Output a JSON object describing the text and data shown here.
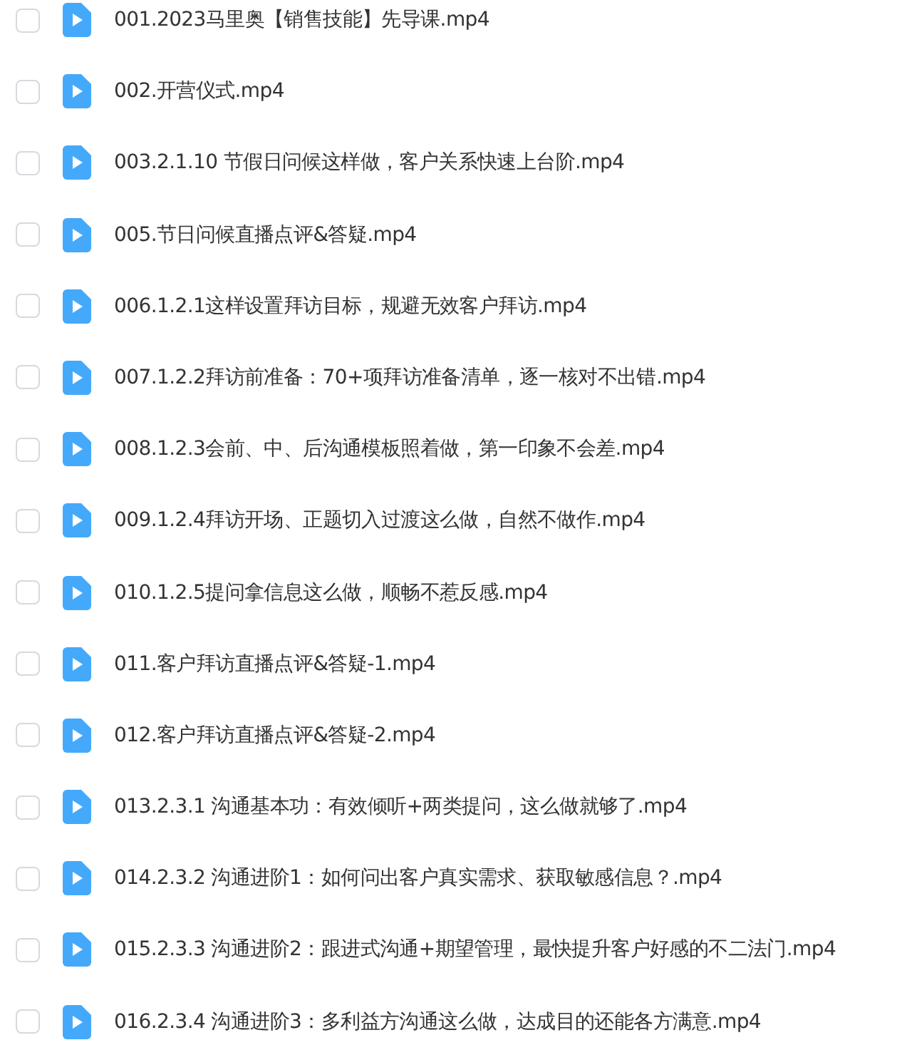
{
  "files": [
    {
      "name": "001.2023马里奥【销售技能】先导课.mp4",
      "checked": false
    },
    {
      "name": "002.开营仪式.mp4",
      "checked": false
    },
    {
      "name": "003.2.1.10 节假日问候这样做，客户关系快速上台阶.mp4",
      "checked": false
    },
    {
      "name": "005.节日问候直播点评&答疑.mp4",
      "checked": false
    },
    {
      "name": "006.1.2.1这样设置拜访目标，规避无效客户拜访.mp4",
      "checked": false
    },
    {
      "name": "007.1.2.2拜访前准备：70+项拜访准备清单，逐一核对不出错.mp4",
      "checked": false
    },
    {
      "name": "008.1.2.3会前、中、后沟通模板照着做，第一印象不会差.mp4",
      "checked": false
    },
    {
      "name": "009.1.2.4拜访开场、正题切入过渡这么做，自然不做作.mp4",
      "checked": false
    },
    {
      "name": "010.1.2.5提问拿信息这么做，顺畅不惹反感.mp4",
      "checked": false
    },
    {
      "name": "011.客户拜访直播点评&答疑-1.mp4",
      "checked": false
    },
    {
      "name": "012.客户拜访直播点评&答疑-2.mp4",
      "checked": false
    },
    {
      "name": "013.2.3.1 沟通基本功：有效倾听+两类提问，这么做就够了.mp4",
      "checked": false
    },
    {
      "name": "014.2.3.2 沟通进阶1：如何问出客户真实需求、获取敏感信息？.mp4",
      "checked": false
    },
    {
      "name": "015.2.3.3 沟通进阶2：跟进式沟通+期望管理，最快提升客户好感的不二法门.mp4",
      "checked": false
    },
    {
      "name": "016.2.3.4 沟通进阶3：多利益方沟通这么做，达成目的还能各方满意.mp4",
      "checked": false
    }
  ]
}
